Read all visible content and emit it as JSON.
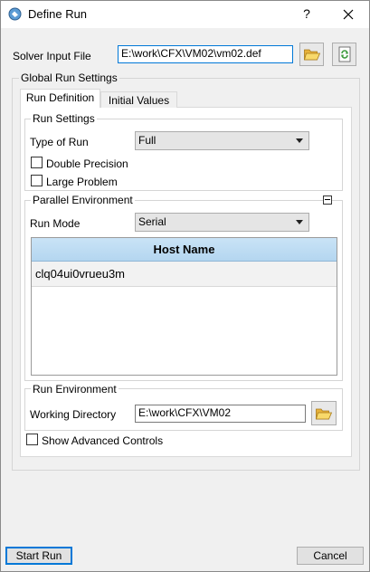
{
  "window": {
    "title": "Define Run",
    "help_label": "?",
    "close_label": "✕"
  },
  "solver_input": {
    "label": "Solver Input File",
    "value": "E:\\work\\CFX\\VM02\\vm02.def"
  },
  "global_run_settings": {
    "title": "Global Run Settings",
    "tabs": [
      {
        "label": "Run Definition",
        "active": true
      },
      {
        "label": "Initial Values",
        "active": false
      }
    ]
  },
  "run_settings": {
    "title": "Run Settings",
    "type_of_run_label": "Type of Run",
    "type_of_run_value": "Full",
    "double_precision_label": "Double Precision",
    "double_precision_checked": false,
    "large_problem_label": "Large Problem",
    "large_problem_checked": false
  },
  "parallel_environment": {
    "title": "Parallel Environment",
    "run_mode_label": "Run Mode",
    "run_mode_value": "Serial",
    "table_header": "Host Name",
    "hosts": [
      "clq04ui0vrueu3m"
    ]
  },
  "run_environment": {
    "title": "Run Environment",
    "working_directory_label": "Working Directory",
    "working_directory_value": "E:\\work\\CFX\\VM02"
  },
  "advanced": {
    "label": "Show Advanced Controls",
    "checked": false
  },
  "footer": {
    "start_label": "Start Run",
    "cancel_label": "Cancel"
  },
  "colors": {
    "accent": "#0078d7",
    "folder_yellow": "#f5c542",
    "refresh_green": "#3c9a3c",
    "table_header_blue": "#bcdcf3"
  }
}
